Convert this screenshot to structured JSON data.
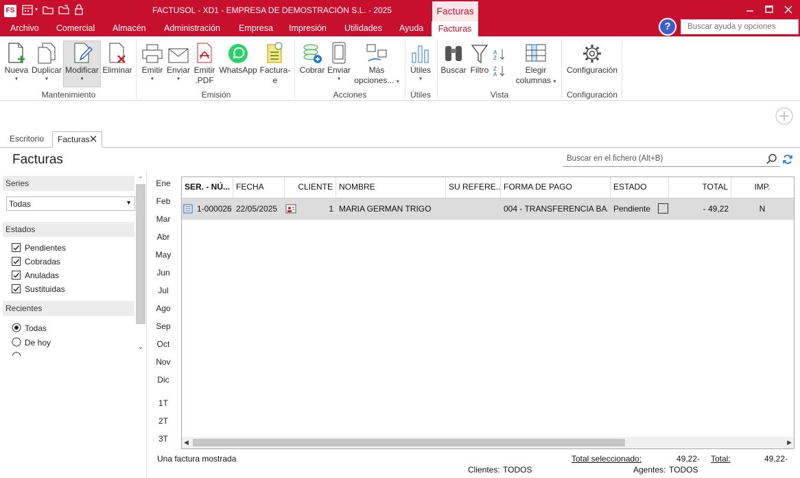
{
  "window": {
    "title": "FACTUSOL - XD1 - EMPRESA DE DEMOSTRACIÓN S.L. - 2025",
    "context_tab": "Facturas",
    "app_badge": "FS"
  },
  "menu": [
    "Archivo",
    "Comercial",
    "Almacén",
    "Administración",
    "Empresa",
    "Impresión",
    "Utilidades",
    "Ayuda",
    "Facturas"
  ],
  "help": {
    "icon": "question-icon",
    "search_placeholder": "Buscar ayuda y opciones"
  },
  "ribbon": {
    "groups": {
      "mantenimiento": "Mantenimiento",
      "emision": "Emisión",
      "acciones": "Acciones",
      "utiles": "Útiles",
      "vista": "Vista",
      "configuracion": "Configuración"
    },
    "buttons": {
      "nueva": "Nueva",
      "duplicar": "Duplicar",
      "modificar": "Modificar",
      "eliminar": "Eliminar",
      "emitir": "Emitir",
      "enviar": "Enviar",
      "emitir_pdf_1": "Emitir",
      "emitir_pdf_2": ".PDF",
      "whatsapp": "WhatsApp",
      "facturae_1": "Factura-",
      "facturae_2": "e",
      "cobrar": "Cobrar",
      "enviar2": "Enviar",
      "mas_1": "Más",
      "mas_2": "opciones...",
      "utiles": "Útiles",
      "buscar": "Buscar",
      "filtro": "Filtro",
      "elegir_1": "Elegir",
      "elegir_2": "columnas",
      "configuracion": "Configuración"
    }
  },
  "doc_tabs": {
    "escritorio": "Escritorio",
    "facturas": "Facturas"
  },
  "page": {
    "title": "Facturas",
    "search_placeholder": "Buscar en el fichero (Alt+B)"
  },
  "left": {
    "series_label": "Series",
    "series_value": "Todas",
    "estados_label": "Estados",
    "estados": [
      "Pendientes",
      "Cobradas",
      "Anuladas",
      "Sustituidas"
    ],
    "recientes_label": "Recientes",
    "recientes": [
      "Todas",
      "De hoy"
    ],
    "recientes_selected": "Todas"
  },
  "months": [
    "Ene",
    "Feb",
    "Mar",
    "Abr",
    "May",
    "Jun",
    "Jul",
    "Ago",
    "Sep",
    "Oct",
    "Nov",
    "Dic"
  ],
  "quarters": [
    "1T",
    "2T",
    "3T"
  ],
  "table": {
    "columns": [
      "SER. - NÚ...",
      "FECHA",
      "CLIENTE",
      "NOMBRE",
      "SU REFERE...",
      "FORMA DE PAGO",
      "ESTADO",
      "TOTAL",
      "IMP."
    ],
    "rows": [
      {
        "numero": "1-000026",
        "fecha": "22/05/2025",
        "cliente": "1",
        "nombre": "MARIA GERMAN TRIGO",
        "su_ref": "",
        "forma_pago": "004 - TRANSFERENCIA BA...",
        "estado": "Pendiente",
        "total": "- 49,22",
        "imp": "N"
      }
    ]
  },
  "footer": {
    "count_text": "Una factura mostrada",
    "total_sel_label": "Total seleccionado:",
    "total_sel_value": "49,22-",
    "total_label": "Total:",
    "total_value": "49,22-",
    "clientes_label": "Clientes:",
    "clientes_value": "TODOS",
    "agentes_label": "Agentes:",
    "agentes_value": "TODOS"
  },
  "colors": {
    "brand": "#c8102e",
    "selection": "#dcdcdc"
  }
}
